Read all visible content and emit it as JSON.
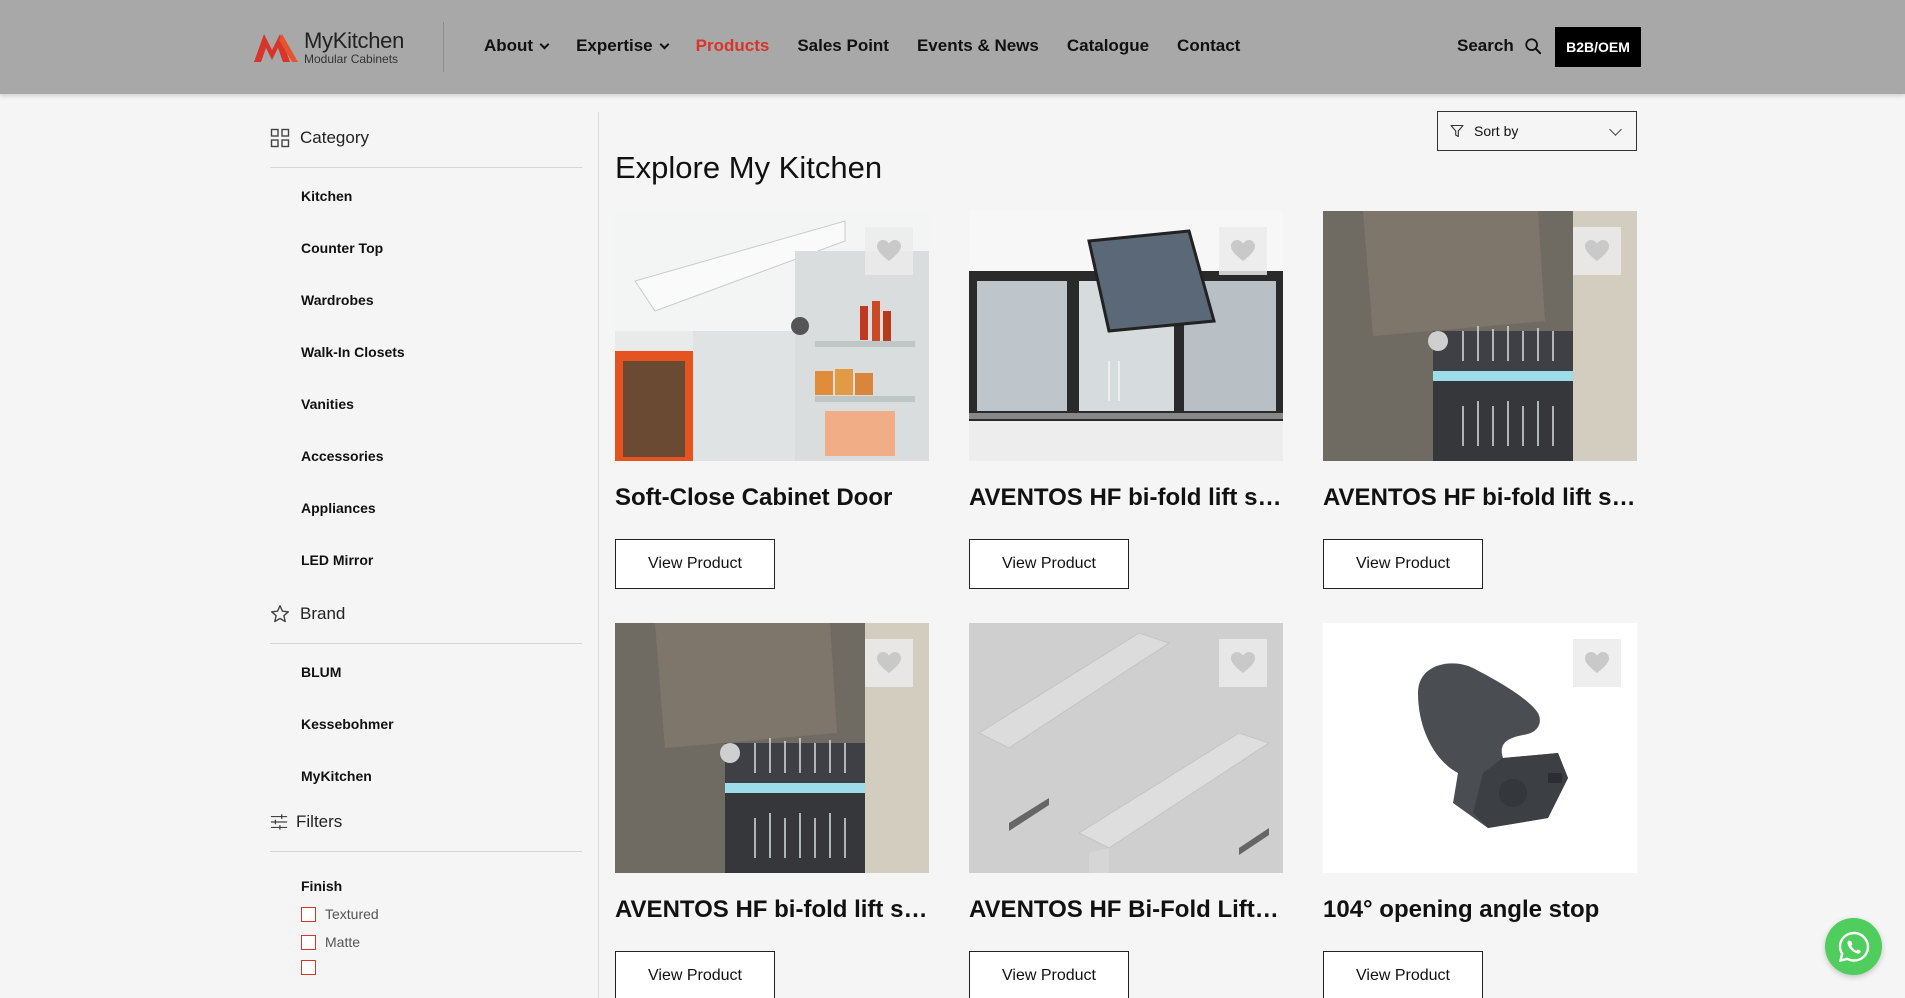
{
  "brand": {
    "name": "MyKitchen",
    "tagline": "Modular Cabinets",
    "accent": "#d7352b"
  },
  "nav": [
    {
      "label": "About",
      "dropdown": true,
      "active": false
    },
    {
      "label": "Expertise",
      "dropdown": true,
      "active": false
    },
    {
      "label": "Products",
      "dropdown": false,
      "active": true
    },
    {
      "label": "Sales Point",
      "dropdown": false,
      "active": false
    },
    {
      "label": "Events & News",
      "dropdown": false,
      "active": false
    },
    {
      "label": "Catalogue",
      "dropdown": false,
      "active": false
    },
    {
      "label": "Contact",
      "dropdown": false,
      "active": false
    }
  ],
  "header": {
    "search_label": "Search",
    "b2b_label": "B2B/OEM"
  },
  "sidebar": {
    "category_title": "Category",
    "categories": [
      "Kitchen",
      "Counter Top",
      "Wardrobes",
      "Walk-In Closets",
      "Vanities",
      "Accessories",
      "Appliances",
      "LED Mirror"
    ],
    "brand_title": "Brand",
    "brands": [
      "BLUM",
      "Kessebohmer",
      "MyKitchen"
    ],
    "filters_title": "Filters",
    "finish_title": "Finish",
    "finish_options": [
      "Textured",
      "Matte"
    ]
  },
  "main": {
    "sort_label": "Sort by",
    "title": "Explore My Kitchen",
    "view_label": "View Product",
    "products": [
      {
        "title": "Soft-Close Cabinet Door",
        "image": "white-lift-cabinet"
      },
      {
        "title": "AVENTOS HF bi-fold lift system",
        "image": "glass-bifold-cabinet"
      },
      {
        "title": "AVENTOS HF bi-fold lift system",
        "image": "grey-lift-cabinet"
      },
      {
        "title": "AVENTOS HF bi-fold lift system",
        "image": "grey-lift-cabinet"
      },
      {
        "title": "AVENTOS HF Bi-Fold Lift System",
        "image": "cover-caps"
      },
      {
        "title": "104° opening angle stop",
        "image": "angle-stop-part"
      }
    ]
  }
}
